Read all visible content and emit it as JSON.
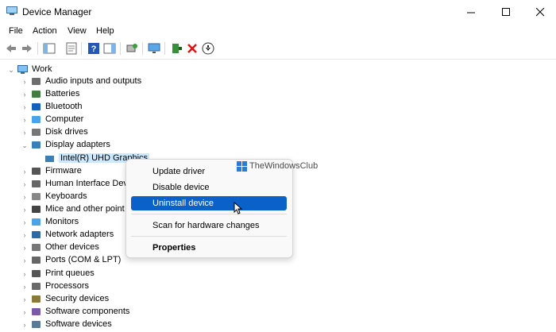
{
  "window": {
    "title": "Device Manager",
    "controls": {
      "minimize": "—",
      "maximize": "☐",
      "close": "✕"
    }
  },
  "menu": [
    "File",
    "Action",
    "View",
    "Help"
  ],
  "tree": {
    "root": "Work",
    "categories": [
      {
        "label": "Audio inputs and outputs",
        "icon": "speaker-icon",
        "expanded": false
      },
      {
        "label": "Batteries",
        "icon": "battery-icon",
        "expanded": false
      },
      {
        "label": "Bluetooth",
        "icon": "bluetooth-icon",
        "expanded": false
      },
      {
        "label": "Computer",
        "icon": "computer-icon",
        "expanded": false
      },
      {
        "label": "Disk drives",
        "icon": "disk-drive-icon",
        "expanded": false
      },
      {
        "label": "Display adapters",
        "icon": "display-adapter-icon",
        "expanded": true
      },
      {
        "label": "Firmware",
        "icon": "firmware-icon",
        "expanded": false
      },
      {
        "label": "Human Interface Dev",
        "icon": "hid-icon",
        "expanded": false
      },
      {
        "label": "Keyboards",
        "icon": "keyboard-icon",
        "expanded": false
      },
      {
        "label": "Mice and other point",
        "icon": "mouse-icon",
        "expanded": false
      },
      {
        "label": "Monitors",
        "icon": "monitor-icon",
        "expanded": false
      },
      {
        "label": "Network adapters",
        "icon": "network-adapter-icon",
        "expanded": false
      },
      {
        "label": "Other devices",
        "icon": "other-device-icon",
        "expanded": false
      },
      {
        "label": "Ports (COM & LPT)",
        "icon": "port-icon",
        "expanded": false
      },
      {
        "label": "Print queues",
        "icon": "printer-icon",
        "expanded": false
      },
      {
        "label": "Processors",
        "icon": "processor-icon",
        "expanded": false
      },
      {
        "label": "Security devices",
        "icon": "security-device-icon",
        "expanded": false
      },
      {
        "label": "Software components",
        "icon": "software-component-icon",
        "expanded": false
      },
      {
        "label": "Software devices",
        "icon": "software-device-icon",
        "expanded": false
      }
    ],
    "selected_child": "Intel(R) UHD Graphics"
  },
  "context_menu": {
    "items": [
      "Update driver",
      "Disable device",
      "Uninstall device",
      "Scan for hardware changes",
      "Properties"
    ],
    "highlighted": "Uninstall device"
  },
  "watermark": "TheWindowsClub",
  "colors": {
    "highlight": "#0a62c8",
    "selection": "#cce8ff",
    "accent": "#2b7bd6"
  }
}
